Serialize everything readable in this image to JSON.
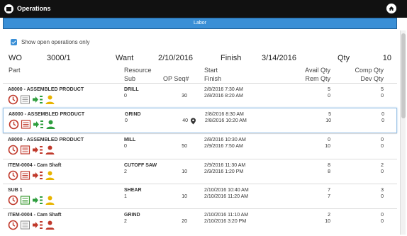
{
  "app": {
    "title": "Operations"
  },
  "labor_bar": {
    "label": "Labor"
  },
  "filter": {
    "label": "Show open operations only",
    "checked": true
  },
  "summary": {
    "wo_label": "WO",
    "wo_value": "3000/1",
    "want_label": "Want",
    "want_value": "2/10/2016",
    "finish_label": "Finish",
    "finish_value": "3/14/2016",
    "qty_label": "Qty",
    "qty_value": "10"
  },
  "headers": {
    "part": "Part",
    "resource": "Resource",
    "sub": "Sub",
    "opseq": "OP Seq#",
    "start": "Start",
    "finish": "Finish",
    "avail_qty": "Avail Qty",
    "rem_qty": "Rem Qty",
    "comp_qty": "Comp Qty",
    "dev_qty": "Dev Qty"
  },
  "colors": {
    "accent": "#3a8fd6",
    "clock": "#c0392b",
    "doc_red": "#c0392b",
    "doc_green": "#3f9c35",
    "arrow_green": "#2e9e3e",
    "person_gold": "#e8b400",
    "person_green": "#2e9e3e",
    "person_red": "#c0392b"
  },
  "operations": [
    {
      "part": "A8000 - ASSEMBLED PRODUCT",
      "resource": "DRILL",
      "sub": "0",
      "opseq": "30",
      "start": "2/8/2016 7:30 AM",
      "finish": "2/8/2016 8:20 AM",
      "avail": "5",
      "rem": "0",
      "comp": "5",
      "dev": "0",
      "doc_icon": "document-icon",
      "person_icon": "person-gold-icon",
      "pin": false
    },
    {
      "part": "A8000 - ASSEMBLED PRODUCT",
      "resource": "GRIND",
      "sub": "0",
      "opseq": "40",
      "start": "2/8/2016 8:30 AM",
      "finish": "2/8/2016 10:20 AM",
      "avail": "5",
      "rem": "10",
      "comp": "0",
      "dev": "0",
      "doc_icon": "document-red-icon",
      "person_icon": "person-green-icon",
      "pin": true
    },
    {
      "part": "A8000 - ASSEMBLED PRODUCT",
      "resource": "MILL",
      "sub": "0",
      "opseq": "50",
      "start": "2/8/2016 10:30 AM",
      "finish": "2/9/2016 7:50 AM",
      "avail": "0",
      "rem": "10",
      "comp": "0",
      "dev": "0",
      "doc_icon": "document-red-icon",
      "person_icon": "person-red-icon",
      "pin": false
    },
    {
      "part": "ITEM-0004 - Cam Shaft",
      "resource": "CUTOFF SAW",
      "sub": "2",
      "opseq": "10",
      "start": "2/9/2016 11:30 AM",
      "finish": "2/9/2016 1:20 PM",
      "avail": "8",
      "rem": "8",
      "comp": "2",
      "dev": "0",
      "doc_icon": "document-red-icon",
      "person_icon": "person-gold-icon",
      "pin": false
    },
    {
      "part": "SUB 1",
      "resource": "SHEAR",
      "sub": "1",
      "opseq": "10",
      "start": "2/10/2016 10:40 AM",
      "finish": "2/10/2016 11:20 AM",
      "avail": "7",
      "rem": "7",
      "comp": "3",
      "dev": "0",
      "doc_icon": "document-green-icon",
      "person_icon": "person-gold-icon",
      "pin": false
    },
    {
      "part": "ITEM-0004 - Cam Shaft",
      "resource": "GRIND",
      "sub": "2",
      "opseq": "20",
      "start": "2/10/2016 11:10 AM",
      "finish": "2/10/2016 3:20 PM",
      "avail": "2",
      "rem": "10",
      "comp": "0",
      "dev": "0",
      "doc_icon": "document-icon",
      "person_icon": "person-red-icon",
      "pin": false
    }
  ]
}
